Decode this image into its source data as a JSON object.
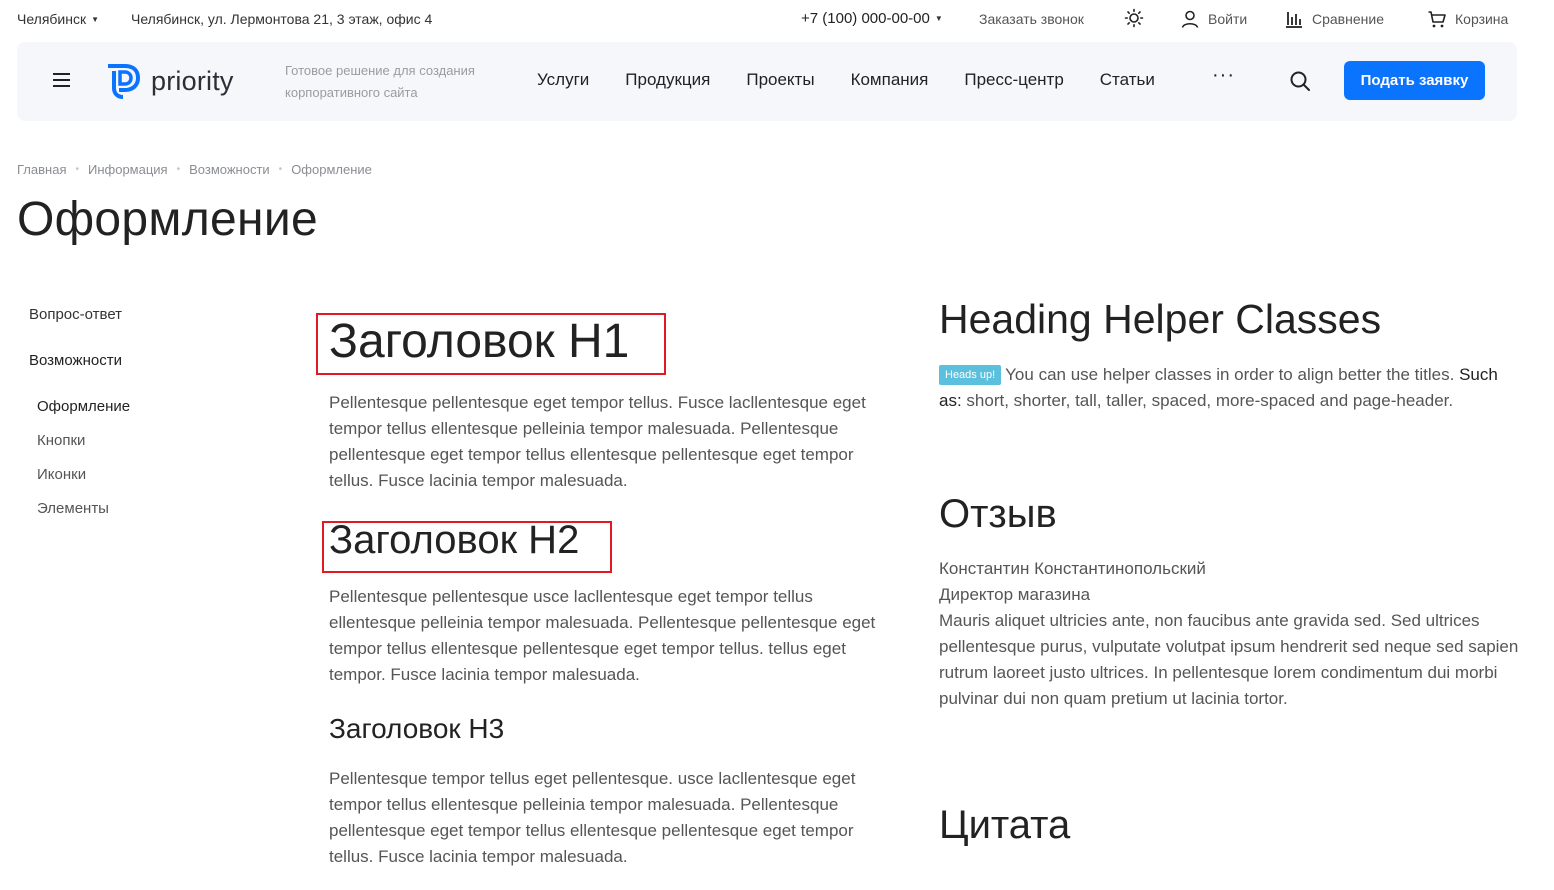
{
  "topbar": {
    "city": "Челябинск",
    "address": "Челябинск, ул. Лермонтова 21, 3 этаж, офис 4",
    "phone": "+7 (100) 000-00-00",
    "callback": "Заказать звонок",
    "login": "Войти",
    "compare": "Сравнение",
    "cart": "Корзина"
  },
  "header": {
    "logo_text": "priority",
    "tagline": "Готовое решение для создания корпоративного сайта",
    "nav": [
      "Услуги",
      "Продукция",
      "Проекты",
      "Компания",
      "Пресс-центр",
      "Статьи"
    ],
    "more": "···",
    "cta": "Подать заявку"
  },
  "breadcrumb": [
    "Главная",
    "Информация",
    "Возможности",
    "Оформление"
  ],
  "page_title": "Оформление",
  "sidebar": {
    "items": [
      "Вопрос-ответ",
      "Возможности"
    ],
    "subitems": [
      "Оформление",
      "Кнопки",
      "Иконки",
      "Элементы"
    ]
  },
  "content": {
    "h1": "Заголовок H1",
    "p1": "Pellentesque pellentesque eget tempor tellus. Fusce lacllentesque eget tempor tellus ellentesque pelleinia tempor malesuada. Pellentesque pellentesque eget tempor tellus ellentesque pellentesque eget tempor tellus. Fusce lacinia tempor malesuada.",
    "h2": "Заголовок H2",
    "p2": "Pellentesque pellentesque usce lacllentesque eget tempor tellus ellentesque pelleinia tempor malesuada. Pellentesque pellentesque eget tempor tellus ellentesque pellentesque eget tempor tellus. tellus eget tempor. Fusce lacinia tempor malesuada.",
    "h3": "Заголовок H3",
    "p3": "Pellentesque tempor tellus eget pellentesque. usce lacllentesque eget tempor tellus ellentesque pelleinia tempor malesuada. Pellentesque pellentesque eget tempor tellus ellentesque pellentesque eget tempor tellus. Fusce lacinia tempor malesuada."
  },
  "right": {
    "helper_title": "Heading Helper Classes",
    "badge": "Heads up!",
    "helper_text": "You can use helper classes in order to align better the titles.",
    "such_as": "Such as:",
    "helper_list": "short, shorter, tall, taller, spaced, more-spaced and page-header.",
    "review_title": "Отзыв",
    "review_name": "Константин Константинопольский",
    "review_role": "Директор магазина",
    "review_text": "Mauris aliquet ultricies ante, non faucibus ante gravida sed. Sed ultrices pellentesque purus, vulputate volutpat ipsum hendrerit sed neque sed sapien rutrum laoreet justo ultrices. In pellentesque lorem condimentum dui morbi pulvinar dui non quam pretium ut lacinia tortor.",
    "quote_title": "Цитата"
  },
  "colors": {
    "accent": "#0a74ff",
    "highlight_box": "#e01b24",
    "badge": "#5bc0de"
  }
}
